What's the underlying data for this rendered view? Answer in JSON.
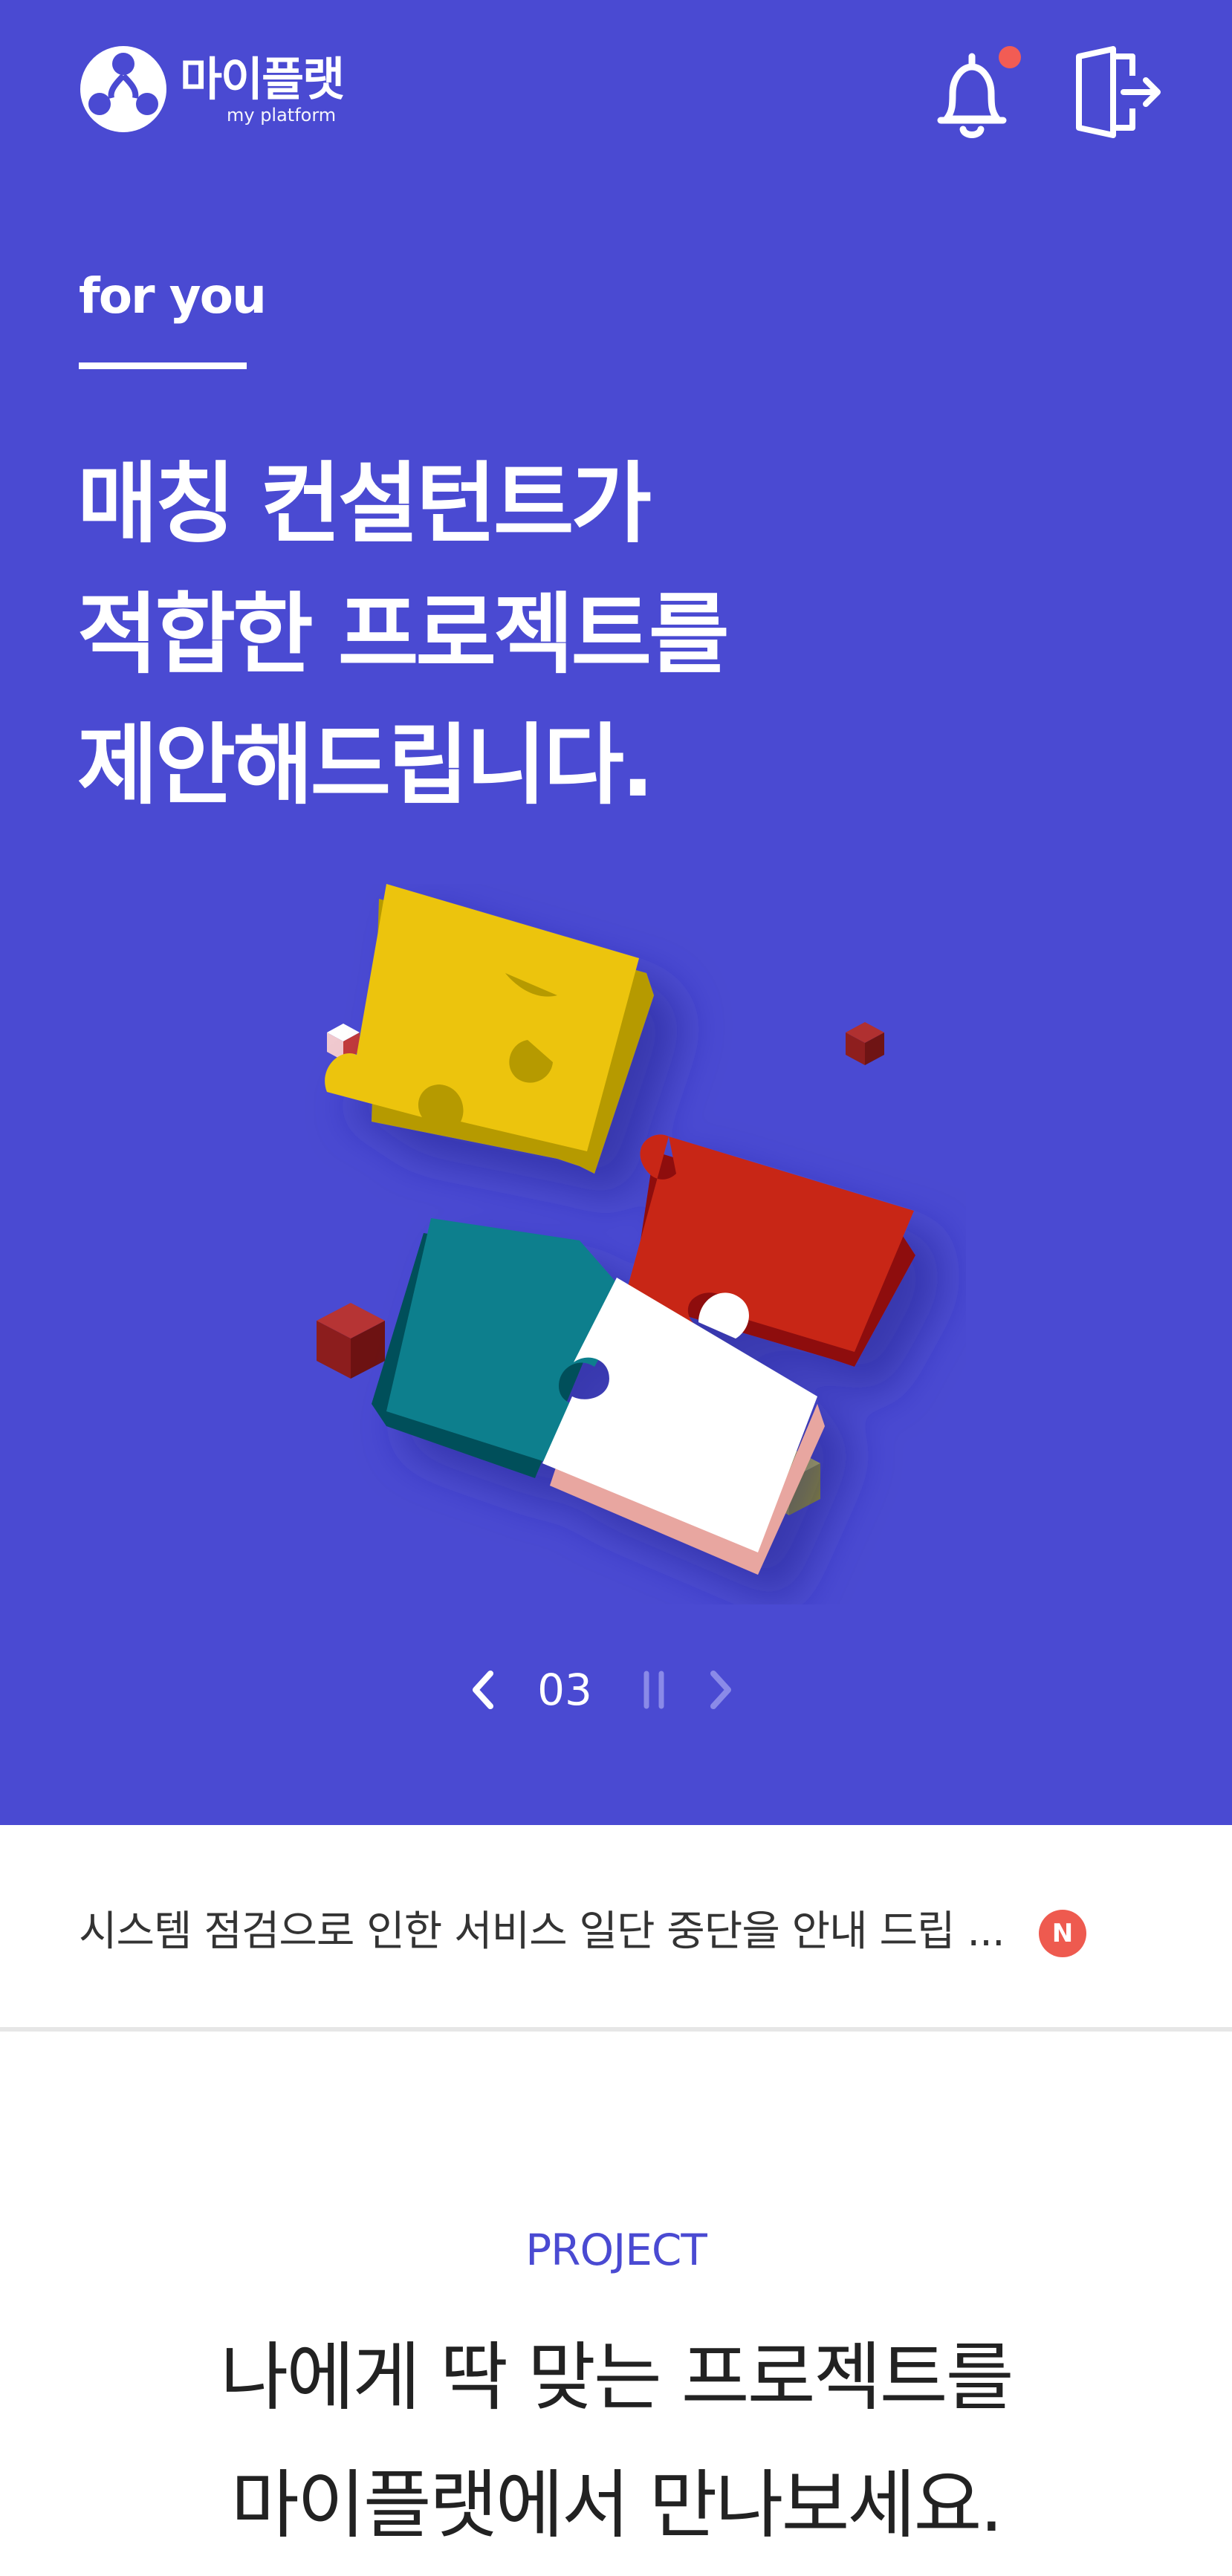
{
  "header": {
    "logo_title": "마이플랫",
    "logo_subtitle": "my platform",
    "icons": {
      "notifications": "bell-icon",
      "logout": "logout-icon"
    },
    "has_unread": true
  },
  "hero": {
    "eyebrow": "for you",
    "headline": [
      "매칭 컨설턴트가",
      "적합한 프로젝트를",
      "제안해드립니다."
    ],
    "illustration": "puzzle-pieces-illustration",
    "pager": {
      "current": "03"
    },
    "colors": {
      "background": "#4a4ad2"
    }
  },
  "notice": {
    "text": "시스템 점검으로 인한 서비스 일단 중단을 안내 드립 ...",
    "badge": "N"
  },
  "project": {
    "label": "PROJECT",
    "title": [
      "나에게 딱 맞는 프로젝트를",
      "마이플랫에서 만나보세요."
    ]
  }
}
